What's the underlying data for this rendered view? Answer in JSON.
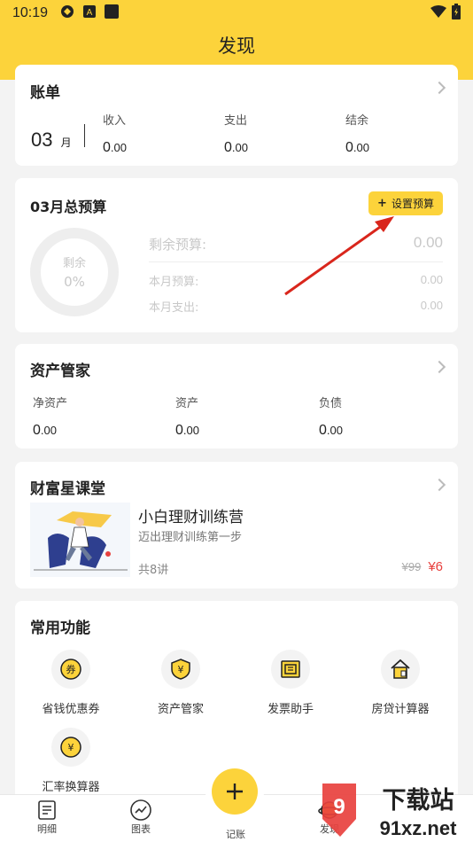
{
  "status": {
    "time": "10:19"
  },
  "header": {
    "title": "发现"
  },
  "bill": {
    "title": "账单",
    "month": "03",
    "month_unit": "月",
    "income_label": "收入",
    "income_int": "0",
    "income_dec": ".00",
    "expense_label": "支出",
    "expense_int": "0",
    "expense_dec": ".00",
    "balance_label": "结余",
    "balance_int": "0",
    "balance_dec": ".00"
  },
  "budget": {
    "title": "03月总预算",
    "button_label": "设置预算",
    "ring_label": "剩余",
    "ring_percent": "0%",
    "remaining_label": "剩余预算:",
    "remaining_value": "0.00",
    "month_budget_label": "本月预算:",
    "month_budget_value": "0.00",
    "month_spend_label": "本月支出:",
    "month_spend_value": "0.00"
  },
  "assets": {
    "title": "资产管家",
    "net_label": "净资产",
    "net_int": "0",
    "net_dec": ".00",
    "asset_label": "资产",
    "asset_int": "0",
    "asset_dec": ".00",
    "debt_label": "负债",
    "debt_int": "0",
    "debt_dec": ".00"
  },
  "course": {
    "title": "财富星课堂",
    "name": "小白理财训练营",
    "subtitle": "迈出理财训练第一步",
    "lessons": "共8讲",
    "old_price": "¥99",
    "price": "¥6"
  },
  "features": {
    "title": "常用功能",
    "items": [
      {
        "label": "省钱优惠券",
        "icon": "coupon-icon"
      },
      {
        "label": "资产管家",
        "icon": "yen-shield-icon"
      },
      {
        "label": "发票助手",
        "icon": "invoice-icon"
      },
      {
        "label": "房贷计算器",
        "icon": "house-icon"
      },
      {
        "label": "汇率换算器",
        "icon": "exchange-icon"
      }
    ]
  },
  "tabs": {
    "detail": "明细",
    "chart": "图表",
    "record": "记账",
    "discover": "发现"
  },
  "watermark": {
    "text_top": "下载站",
    "text_bottom": "91xz.net"
  },
  "colors": {
    "accent": "#fcd33b",
    "price_red": "#e8413e",
    "arrow_red": "#d9261c"
  }
}
